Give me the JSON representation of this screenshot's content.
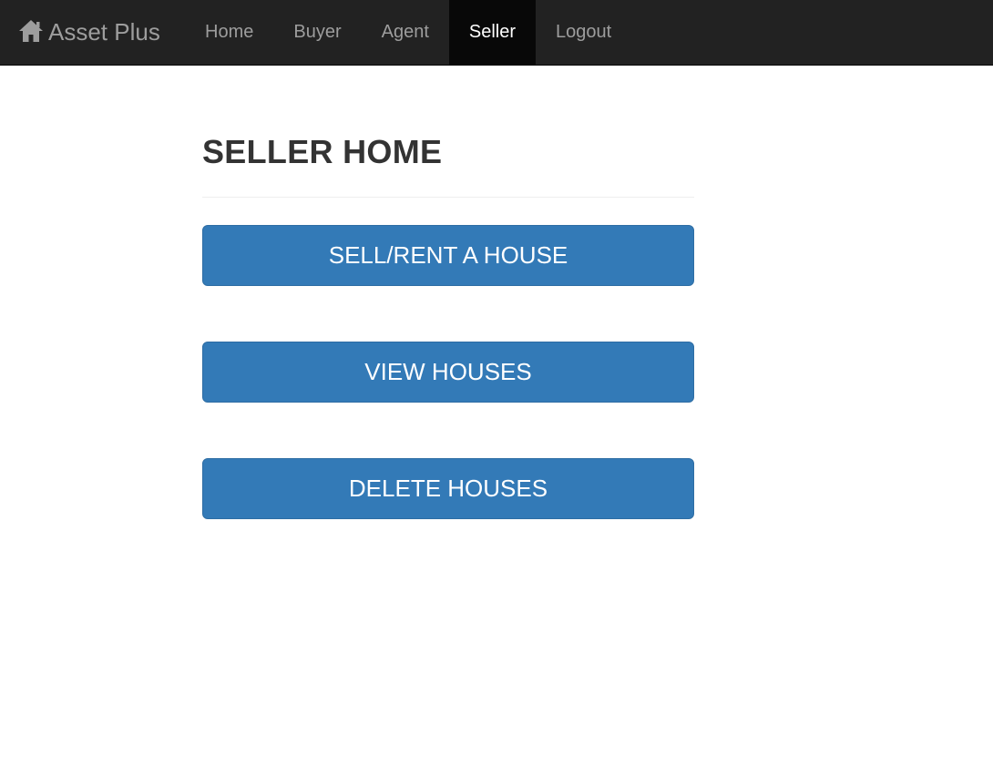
{
  "navbar": {
    "brand": "Asset Plus",
    "brand_icon": "home-icon",
    "items": [
      {
        "label": "Home",
        "active": false
      },
      {
        "label": "Buyer",
        "active": false
      },
      {
        "label": "Agent",
        "active": false
      },
      {
        "label": "Seller",
        "active": true
      },
      {
        "label": "Logout",
        "active": false
      }
    ]
  },
  "main": {
    "title": "SELLER HOME",
    "buttons": [
      {
        "label": "SELL/RENT A HOUSE"
      },
      {
        "label": "VIEW HOUSES"
      },
      {
        "label": "DELETE HOUSES"
      }
    ]
  },
  "colors": {
    "navbar_bg": "#222222",
    "navbar_active_bg": "#080808",
    "nav_text": "#9d9d9d",
    "nav_active_text": "#ffffff",
    "button_primary": "#337ab7",
    "title_text": "#333333"
  }
}
